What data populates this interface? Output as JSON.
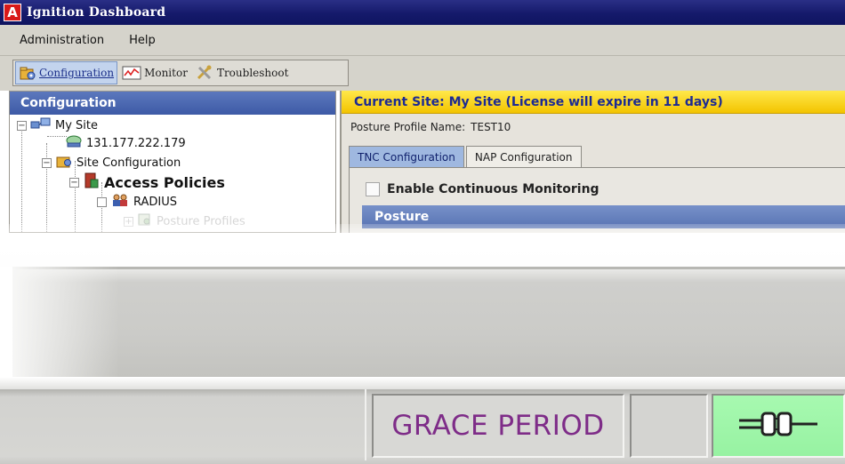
{
  "window": {
    "title": "Ignition Dashboard",
    "app_icon_letter": "A",
    "app_icon_color": "#d81919",
    "titlebar_color": "#151a6b"
  },
  "menu": {
    "items": [
      "Administration",
      "Help"
    ]
  },
  "toolbar": {
    "buttons": [
      {
        "label": "Configuration",
        "icon": "configuration-icon",
        "active": true
      },
      {
        "label": "Monitor",
        "icon": "monitor-chart-icon",
        "active": false
      },
      {
        "label": "Troubleshoot",
        "icon": "troubleshoot-tools-icon",
        "active": false
      }
    ]
  },
  "sidebar": {
    "header": "Configuration",
    "tree": {
      "my_site": "My Site",
      "ip_address": "131.177.222.179",
      "site_configuration": "Site Configuration",
      "access_policies": "Access Policies",
      "radius": "RADIUS",
      "posture_profiles": "Posture Profiles"
    }
  },
  "main": {
    "current_site_banner": "Current Site:  My Site (License will expire in 11 days)",
    "banner_color": "#f3c400",
    "profile_name_label": "Posture Profile Name:",
    "profile_name_value": "TEST10",
    "tabs": [
      {
        "label": "TNC Configuration",
        "active": true
      },
      {
        "label": "NAP Configuration",
        "active": false
      }
    ],
    "checkbox": {
      "label": "Enable Continuous Monitoring",
      "checked": false
    },
    "section_header": "Posture"
  },
  "statusbar": {
    "license_status": "GRACE PERIOD",
    "license_status_color": "#7e2c88",
    "connection_icon": "connected-plug-icon",
    "connection_color": "#97f2a2"
  }
}
